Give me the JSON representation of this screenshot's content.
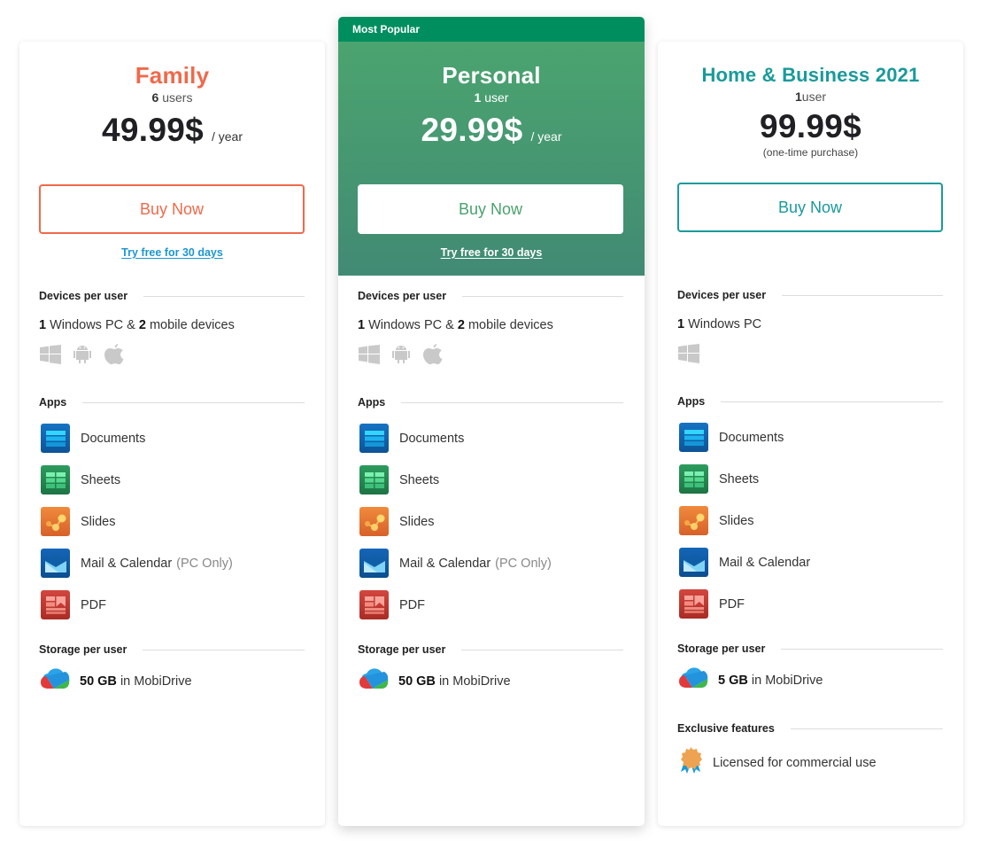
{
  "colors": {
    "family": "#f0694a",
    "personal_green": "#4aa26e",
    "popular_bar": "#018e5e",
    "business": "#1a9a9a",
    "trial_link": "#1e96d2"
  },
  "plans": [
    {
      "id": "family",
      "name": "Family",
      "users_count": "6",
      "users_label": "users",
      "price": "49.99$",
      "period": "/ year",
      "buy_label": "Buy Now",
      "trial_label": "Try free for 30 days",
      "devices_title": "Devices per user",
      "devices": {
        "pc_count": "1",
        "pc_text": "Windows PC &",
        "mobile_count": "2",
        "mobile_text": "mobile devices"
      },
      "os_icons": [
        "windows-icon",
        "android-icon",
        "apple-icon"
      ],
      "apps_title": "Apps",
      "apps": [
        {
          "label": "Documents",
          "note": "",
          "icon": "documents-icon"
        },
        {
          "label": "Sheets",
          "note": "",
          "icon": "sheets-icon"
        },
        {
          "label": "Slides",
          "note": "",
          "icon": "slides-icon"
        },
        {
          "label": "Mail & Calendar",
          "note": "(PC Only)",
          "icon": "mail-calendar-icon"
        },
        {
          "label": "PDF",
          "note": "",
          "icon": "pdf-icon"
        }
      ],
      "storage_title": "Storage per user",
      "storage": {
        "amount": "50 GB",
        "text": "in MobiDrive"
      }
    },
    {
      "id": "personal",
      "badge": "Most Popular",
      "name": "Personal",
      "users_count": "1",
      "users_label": "user",
      "price": "29.99$",
      "period": "/ year",
      "buy_label": "Buy Now",
      "trial_label": "Try free for 30 days",
      "devices_title": "Devices per user",
      "devices": {
        "pc_count": "1",
        "pc_text": "Windows PC &",
        "mobile_count": "2",
        "mobile_text": "mobile devices"
      },
      "os_icons": [
        "windows-icon",
        "android-icon",
        "apple-icon"
      ],
      "apps_title": "Apps",
      "apps": [
        {
          "label": "Documents",
          "note": "",
          "icon": "documents-icon"
        },
        {
          "label": "Sheets",
          "note": "",
          "icon": "sheets-icon"
        },
        {
          "label": "Slides",
          "note": "",
          "icon": "slides-icon"
        },
        {
          "label": "Mail & Calendar",
          "note": "(PC Only)",
          "icon": "mail-calendar-icon"
        },
        {
          "label": "PDF",
          "note": "",
          "icon": "pdf-icon"
        }
      ],
      "storage_title": "Storage per user",
      "storage": {
        "amount": "50 GB",
        "text": "in MobiDrive"
      }
    },
    {
      "id": "business",
      "name": "Home & Business 2021",
      "users_count": "1",
      "users_label": "user",
      "price": "99.99$",
      "price_note": "(one-time purchase)",
      "buy_label": "Buy Now",
      "devices_title": "Devices per user",
      "devices": {
        "pc_count": "1",
        "pc_text": "Windows PC"
      },
      "os_icons": [
        "windows-icon"
      ],
      "apps_title": "Apps",
      "apps": [
        {
          "label": "Documents",
          "note": "",
          "icon": "documents-icon"
        },
        {
          "label": "Sheets",
          "note": "",
          "icon": "sheets-icon"
        },
        {
          "label": "Slides",
          "note": "",
          "icon": "slides-icon"
        },
        {
          "label": "Mail & Calendar",
          "note": "",
          "icon": "mail-calendar-icon"
        },
        {
          "label": "PDF",
          "note": "",
          "icon": "pdf-icon"
        }
      ],
      "storage_title": "Storage per user",
      "storage": {
        "amount": "5 GB",
        "text": "in MobiDrive"
      },
      "exclusive_title": "Exclusive features",
      "exclusive": [
        {
          "label": "Licensed for commercial use",
          "icon": "award-badge-icon"
        }
      ]
    }
  ]
}
